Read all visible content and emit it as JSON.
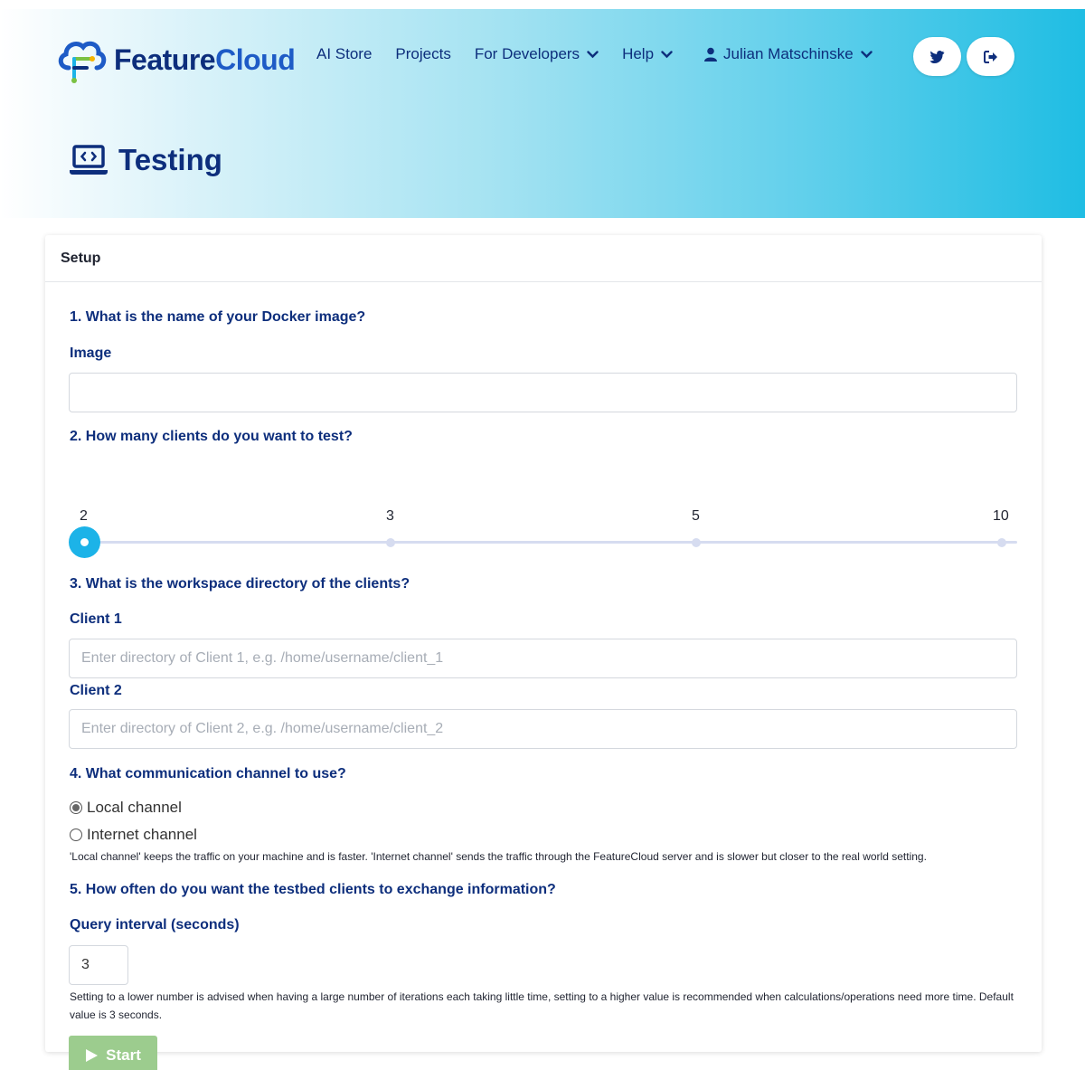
{
  "brand": {
    "name_part1": "Feature",
    "name_part2": "Cloud"
  },
  "nav": {
    "ai_store": "AI Store",
    "projects": "Projects",
    "for_developers": "For Developers",
    "help": "Help",
    "user": "Julian Matschinske"
  },
  "header_buttons": {
    "twitter_icon": "twitter-icon",
    "logout_icon": "logout-icon"
  },
  "page": {
    "title": "Testing",
    "title_icon": "laptop-code-icon"
  },
  "card": {
    "header": "Setup",
    "q1": "1. What is the name of your Docker image?",
    "image_label": "Image",
    "image_value": "",
    "q2": "2. How many clients do you want to test?",
    "slider_ticks": [
      "2",
      "3",
      "5",
      "10"
    ],
    "slider_selected": "2",
    "q3": "3. What is the workspace directory of the clients?",
    "client1_label": "Client 1",
    "client1_placeholder": "Enter directory of Client 1, e.g. /home/username/client_1",
    "client2_label": "Client 2",
    "client2_placeholder": "Enter directory of Client 2, e.g. /home/username/client_2",
    "q4": "4. What communication channel to use?",
    "channel_local": "Local channel",
    "channel_internet": "Internet channel",
    "channel_selected": "Local channel",
    "channel_help": "'Local channel' keeps the traffic on your machine and is faster. 'Internet channel' sends the traffic through the FeatureCloud server and is slower but closer to the real world setting.",
    "q5": "5. How often do you want the testbed clients to exchange information?",
    "query_label": "Query interval (seconds)",
    "query_value": "3",
    "query_help": "Setting to a lower number is advised when having a large number of iterations each taking little time, setting to a higher value is recommended when calculations/operations need more time. Default value is 3 seconds.",
    "start_label": "Start"
  },
  "colors": {
    "accent": "#1cb3e8",
    "title": "#0d2e7c",
    "start_button": "#9ccc8e"
  }
}
